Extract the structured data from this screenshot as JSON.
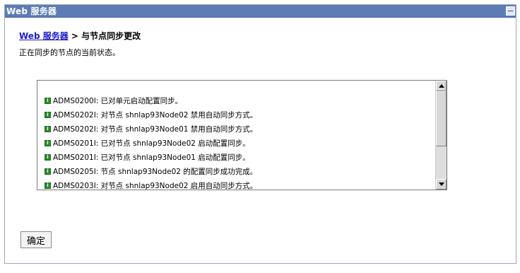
{
  "panel": {
    "title": "Web 服务器"
  },
  "breadcrumb": {
    "link": "Web 服务器",
    "separator": ">",
    "current": "与节点同步更改"
  },
  "description": "正在同步的节点的当前状态。",
  "log": {
    "entries": [
      "ADMS0200I: 已对单元启动配置同步。",
      "ADMS0202I: 对节点 shnlap93Node02 禁用自动同步方式。",
      "ADMS0202I: 对节点 shnlap93Node01 禁用自动同步方式。",
      "ADMS0201I: 已对节点 shnlap93Node02 启动配置同步。",
      "ADMS0201I: 已对节点 shnlap93Node01 启动配置同步。",
      "ADMS0205I: 节点 shnlap93Node02 的配置同步成功完成。",
      "ADMS0203I: 对节点 shnlap93Node02 启用自动同步方式。"
    ]
  },
  "ok_button": "确定",
  "colors": {
    "titlebar": "#5d7cb5",
    "link": "#1a1acb",
    "info_icon": "#2e8a2e"
  }
}
